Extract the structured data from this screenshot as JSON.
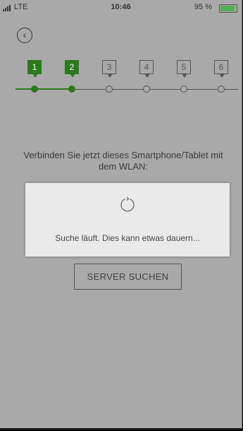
{
  "status_bar": {
    "carrier": "LTE",
    "time": "10:46",
    "battery_percent": "95 %",
    "battery_level": 0.95
  },
  "header": {
    "back_icon": "chevron-left-circle-icon"
  },
  "stepper": {
    "current_step": 2,
    "steps": [
      {
        "label": "1",
        "state": "done"
      },
      {
        "label": "2",
        "state": "done"
      },
      {
        "label": "3",
        "state": "todo"
      },
      {
        "label": "4",
        "state": "todo"
      },
      {
        "label": "5",
        "state": "todo"
      },
      {
        "label": "6",
        "state": "todo"
      }
    ]
  },
  "main": {
    "instruction": "Verbinden Sie jetzt dieses Smartphone/Tablet mit dem WLAN:",
    "server_button_label": "SERVER SUCHEN"
  },
  "dialog": {
    "icon": "refresh-spinner-icon",
    "message": "Suche läuft. Dies kann etwas dauern..."
  },
  "colors": {
    "accent": "#2b7a1c",
    "overlay_background": "#a9a9a9",
    "dialog_background": "#eaeaea"
  }
}
